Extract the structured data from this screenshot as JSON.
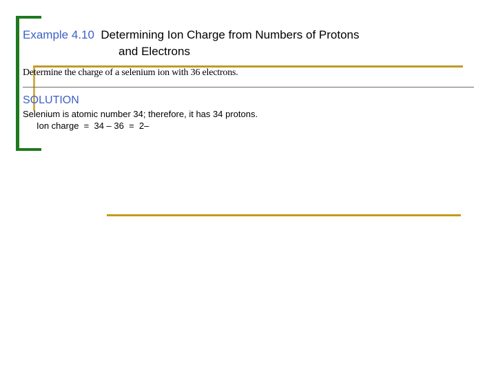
{
  "example": {
    "number": "Example 4.10",
    "title_line1": "Determining Ion Charge from Numbers of Protons",
    "title_line2": "and Electrons"
  },
  "problem": "Determine the charge of a selenium ion with 36 electrons.",
  "solution": {
    "heading": "SOLUTION",
    "line1": "Selenium is atomic number 34; therefore, it has 34 protons.",
    "line2": "Ion charge  =  34 – 36  =  2–"
  },
  "colors": {
    "accent_blue": "#3d5fc6",
    "bracket_green": "#1e7a1e",
    "frame_gold": "#bf9a2a"
  }
}
